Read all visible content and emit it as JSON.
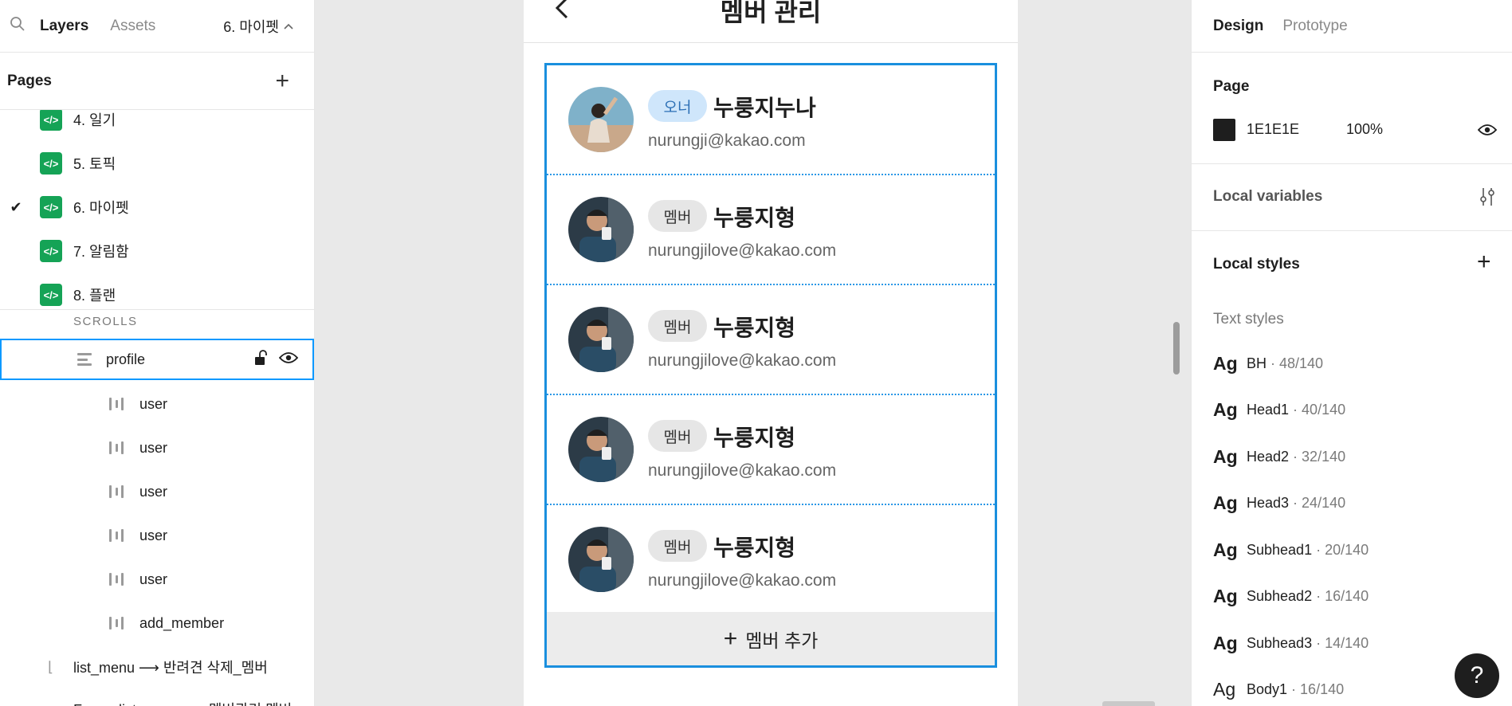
{
  "left_panel": {
    "tabs": {
      "layers": "Layers",
      "assets": "Assets"
    },
    "current_page": "6. 마이펫",
    "pages_title": "Pages",
    "pages": [
      {
        "label": "4. 일기",
        "checked": false
      },
      {
        "label": "5. 토픽",
        "checked": false
      },
      {
        "label": "6. 마이펫",
        "checked": true
      },
      {
        "label": "7. 알림함",
        "checked": false
      },
      {
        "label": "8. 플랜",
        "checked": false
      }
    ],
    "section_label": "SCROLLS",
    "selected_layer": "profile",
    "child_layers": [
      "user",
      "user",
      "user",
      "user",
      "user",
      "add_member"
    ],
    "bottom_layer": "list_menu ⟶ 반려견 삭제_멤버",
    "cut_layer": "Frame list_menu ⟶ 멤버관리 멤버"
  },
  "canvas": {
    "header_title": "멤버 관리",
    "members": [
      {
        "role": "오너",
        "role_type": "owner",
        "name": "누룽지누나",
        "email": "nurungji@kakao.com"
      },
      {
        "role": "멤버",
        "role_type": "member",
        "name": "누룽지형",
        "email": "nurungjilove@kakao.com"
      },
      {
        "role": "멤버",
        "role_type": "member",
        "name": "누룽지형",
        "email": "nurungjilove@kakao.com"
      },
      {
        "role": "멤버",
        "role_type": "member",
        "name": "누룽지형",
        "email": "nurungjilove@kakao.com"
      },
      {
        "role": "멤버",
        "role_type": "member",
        "name": "누룽지형",
        "email": "nurungjilove@kakao.com"
      }
    ],
    "add_member_label": "멤버 추가"
  },
  "right_panel": {
    "tabs": {
      "design": "Design",
      "prototype": "Prototype"
    },
    "page_title": "Page",
    "page_color": "1E1E1E",
    "page_opacity": "100%",
    "local_variables": "Local variables",
    "local_styles": "Local styles",
    "text_styles_title": "Text styles",
    "text_styles": [
      {
        "name": "BH",
        "size": " · 48/140"
      },
      {
        "name": "Head1",
        "size": " · 40/140"
      },
      {
        "name": "Head2",
        "size": " · 32/140"
      },
      {
        "name": "Head3",
        "size": " · 24/140"
      },
      {
        "name": "Subhead1",
        "size": " · 20/140"
      },
      {
        "name": "Subhead2",
        "size": " · 16/140"
      },
      {
        "name": "Subhead3",
        "size": " · 14/140"
      },
      {
        "name": "Body1",
        "size": " · 16/140"
      }
    ],
    "help": "?"
  },
  "colors": {
    "selection_blue": "#0d99ff",
    "frame_blue": "#1a8fde",
    "page_bg": "#1E1E1E",
    "component_green": "#15a356"
  }
}
